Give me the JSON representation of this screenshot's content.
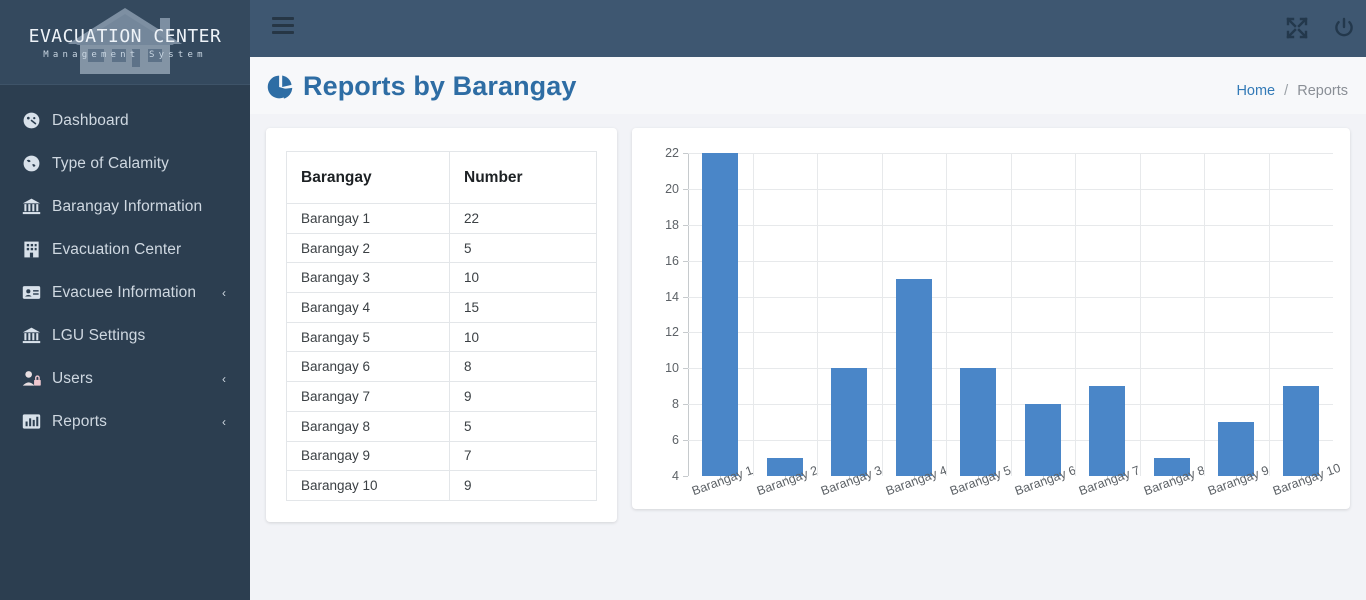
{
  "sidebar": {
    "logo": {
      "icon": "house-icon",
      "title": "EVACUATION CENTER",
      "subtitle": "Management System"
    },
    "items": [
      {
        "label": "Dashboard",
        "icon": "tachometer-icon",
        "caret": ""
      },
      {
        "label": "Type of Calamity",
        "icon": "globe-icon",
        "caret": ""
      },
      {
        "label": "Barangay Information",
        "icon": "bank-icon",
        "caret": ""
      },
      {
        "label": "Evacuation Center",
        "icon": "building-icon",
        "caret": ""
      },
      {
        "label": "Evacuee Information",
        "icon": "id-card-icon",
        "caret": "‹"
      },
      {
        "label": "LGU Settings",
        "icon": "bank-icon",
        "caret": ""
      },
      {
        "label": "Users",
        "icon": "user-lock-icon",
        "caret": "‹"
      },
      {
        "label": "Reports",
        "icon": "chart-bar-icon",
        "caret": "‹"
      }
    ]
  },
  "header": {
    "menu_toggle": "hamburger-icon",
    "fullscreen": "fullscreen-icon",
    "power": "power-icon"
  },
  "page": {
    "title": "Reports by Barangay",
    "title_icon": "pie-chart-icon",
    "breadcrumb": {
      "home": "Home",
      "separator": "/",
      "current": "Reports"
    }
  },
  "table": {
    "columns": [
      "Barangay",
      "Number"
    ],
    "rows": [
      [
        "Barangay 1",
        "22"
      ],
      [
        "Barangay 2",
        "5"
      ],
      [
        "Barangay 3",
        "10"
      ],
      [
        "Barangay 4",
        "15"
      ],
      [
        "Barangay 5",
        "10"
      ],
      [
        "Barangay 6",
        "8"
      ],
      [
        "Barangay 7",
        "9"
      ],
      [
        "Barangay 8",
        "5"
      ],
      [
        "Barangay 9",
        "7"
      ],
      [
        "Barangay 10",
        "9"
      ]
    ]
  },
  "chart_data": {
    "type": "bar",
    "title": "",
    "xlabel": "",
    "ylabel": "",
    "categories": [
      "Barangay 1",
      "Barangay 2",
      "Barangay 3",
      "Barangay 4",
      "Barangay 5",
      "Barangay 6",
      "Barangay 7",
      "Barangay 8",
      "Barangay 9",
      "Barangay 10"
    ],
    "values": [
      22,
      5,
      10,
      15,
      10,
      8,
      9,
      5,
      7,
      9
    ],
    "yticks": [
      4,
      6,
      8,
      10,
      12,
      14,
      16,
      18,
      20,
      22
    ],
    "ylim": [
      4,
      22
    ],
    "grid": true,
    "legend": false,
    "bar_color": "#4a86c8",
    "xtick_rotation": -20
  },
  "colors": {
    "sidebar_bg": "#2c3e50",
    "logo_bg": "#34495e",
    "header_bg": "#3e5771",
    "accent_blue": "#2e6da4",
    "link_blue": "#337ab7",
    "page_bg": "#f2f3f7",
    "bar_blue": "#4a86c8"
  }
}
